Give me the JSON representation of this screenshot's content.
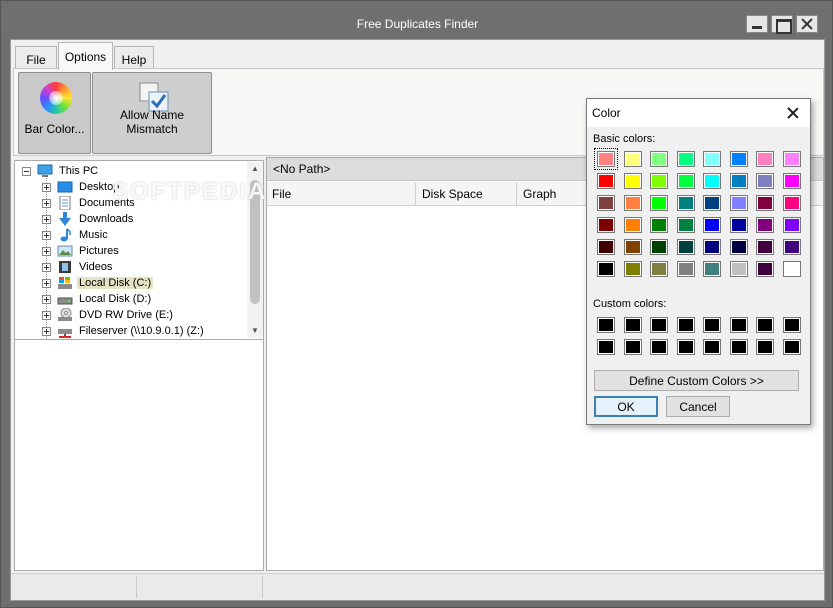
{
  "window": {
    "title": "Free Duplicates Finder"
  },
  "menu_tabs": [
    {
      "label": "File"
    },
    {
      "label": "Options",
      "active": true
    },
    {
      "label": "Help"
    }
  ],
  "ribbon": {
    "bar_color_label": "Bar Color...",
    "allow_name_mismatch_label": "Allow Name Mismatch"
  },
  "tree": {
    "root": {
      "label": "This PC",
      "icon": "computer-icon"
    },
    "items": [
      {
        "label": "Desktop",
        "icon": "desktop-icon"
      },
      {
        "label": "Documents",
        "icon": "documents-icon"
      },
      {
        "label": "Downloads",
        "icon": "downloads-icon"
      },
      {
        "label": "Music",
        "icon": "music-icon"
      },
      {
        "label": "Pictures",
        "icon": "pictures-icon"
      },
      {
        "label": "Videos",
        "icon": "videos-icon"
      },
      {
        "label": "Local Disk (C:)",
        "icon": "system-drive-icon",
        "selected": true
      },
      {
        "label": "Local Disk (D:)",
        "icon": "drive-icon"
      },
      {
        "label": "DVD RW Drive (E:)",
        "icon": "dvd-drive-icon"
      },
      {
        "label": "Fileserver (\\\\10.9.0.1) (Z:)",
        "icon": "network-drive-icon"
      }
    ]
  },
  "results": {
    "path": "<No Path>",
    "columns": [
      "File",
      "Disk Space",
      "Graph"
    ]
  },
  "color_dialog": {
    "title": "Color",
    "basic_colors_label": "Basic colors:",
    "custom_colors_label": "Custom colors:",
    "basic_colors": [
      "#ff8080",
      "#ffff80",
      "#80ff80",
      "#00ff80",
      "#80ffff",
      "#0080ff",
      "#ff80c0",
      "#ff80ff",
      "#ff0000",
      "#ffff00",
      "#80ff00",
      "#00ff40",
      "#00ffff",
      "#0080c0",
      "#8080c0",
      "#ff00ff",
      "#804040",
      "#ff8040",
      "#00ff00",
      "#008080",
      "#004080",
      "#8080ff",
      "#800040",
      "#ff0080",
      "#800000",
      "#ff8000",
      "#008000",
      "#008040",
      "#0000ff",
      "#0000a0",
      "#800080",
      "#8000ff",
      "#400000",
      "#804000",
      "#004000",
      "#004040",
      "#000080",
      "#000040",
      "#400040",
      "#400080",
      "#000000",
      "#808000",
      "#808040",
      "#808080",
      "#408080",
      "#c0c0c0",
      "#400040",
      "#ffffff"
    ],
    "selected_index": 0,
    "custom_colors": [
      "#000000",
      "#000000",
      "#000000",
      "#000000",
      "#000000",
      "#000000",
      "#000000",
      "#000000",
      "#000000",
      "#000000",
      "#000000",
      "#000000",
      "#000000",
      "#000000",
      "#000000",
      "#000000"
    ],
    "define_button": "Define Custom Colors >>",
    "ok_button": "OK",
    "cancel_button": "Cancel"
  },
  "watermark": "SOFTPEDIA"
}
